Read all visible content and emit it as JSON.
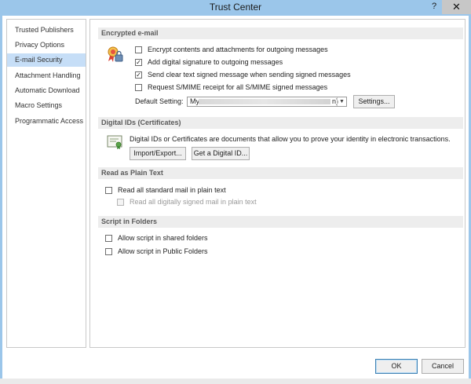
{
  "window": {
    "title": "Trust Center",
    "help_glyph": "?",
    "close_glyph": "✕"
  },
  "nav": {
    "items": [
      {
        "label": "Trusted Publishers"
      },
      {
        "label": "Privacy Options"
      },
      {
        "label": "E-mail Security"
      },
      {
        "label": "Attachment Handling"
      },
      {
        "label": "Automatic Download"
      },
      {
        "label": "Macro Settings"
      },
      {
        "label": "Programmatic Access"
      }
    ],
    "selected": "E-mail Security"
  },
  "encrypted": {
    "heading": "Encrypted e-mail",
    "icon": "certificate-lock-icon",
    "options": [
      {
        "label": "Encrypt contents and attachments for outgoing messages",
        "checked": false
      },
      {
        "label": "Add digital signature to outgoing messages",
        "checked": true
      },
      {
        "label": "Send clear text signed message when sending signed messages",
        "checked": true
      },
      {
        "label": "Request S/MIME receipt for all S/MIME signed messages",
        "checked": false
      }
    ],
    "default_setting_label": "Default Setting:",
    "default_setting_value_start": "My",
    "default_setting_value_end": "n)",
    "settings_button": "Settings..."
  },
  "digital_ids": {
    "heading": "Digital IDs (Certificates)",
    "icon": "certificate-icon",
    "description": "Digital IDs or Certificates are documents that allow you to prove your identity in electronic transactions.",
    "import_export_button": "Import/Export...",
    "get_id_button": "Get a Digital ID..."
  },
  "plain_text": {
    "heading": "Read as Plain Text",
    "options": [
      {
        "label": "Read all standard mail in plain text",
        "checked": false,
        "disabled": false
      },
      {
        "label": "Read all digitally signed mail in plain text",
        "checked": false,
        "disabled": true
      }
    ]
  },
  "script_folders": {
    "heading": "Script in Folders",
    "options": [
      {
        "label": "Allow script in shared folders",
        "checked": false
      },
      {
        "label": "Allow script in Public Folders",
        "checked": false
      }
    ]
  },
  "footer": {
    "ok_button": "OK",
    "cancel_button": "Cancel"
  },
  "check_glyph": "✓",
  "colors": {
    "titlebar": "#9bc6ea",
    "nav_selected": "#c6def7",
    "section_header": "#ededed",
    "close_button": "#c7c7c7"
  }
}
